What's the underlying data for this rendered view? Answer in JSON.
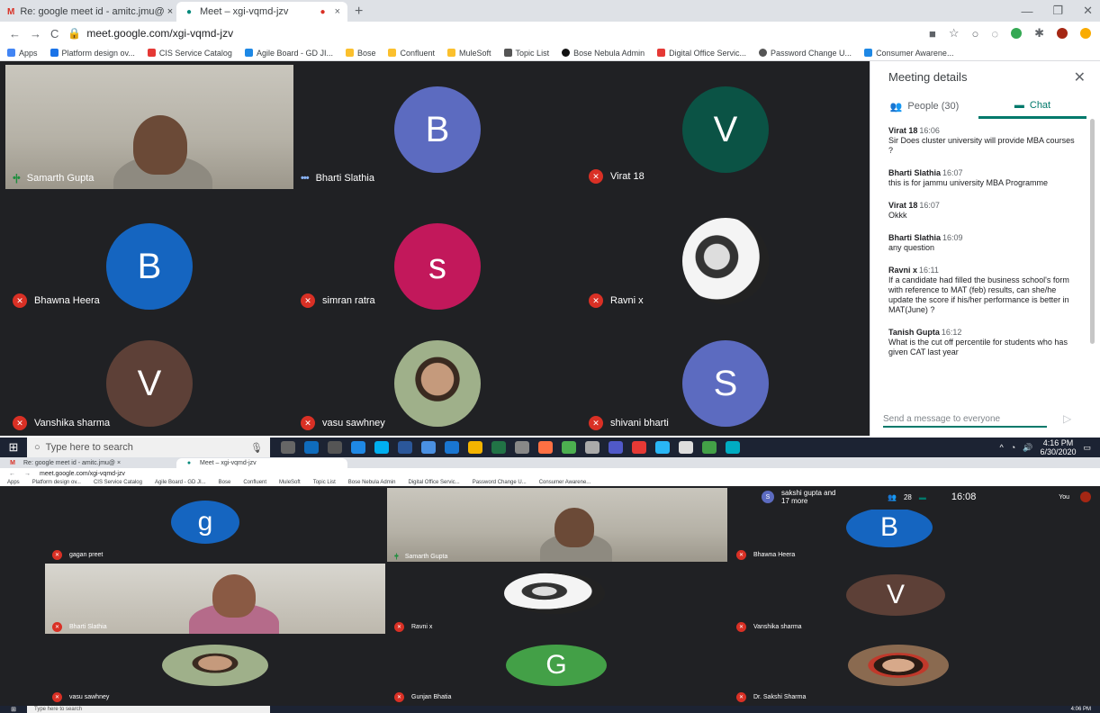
{
  "top": {
    "tabs": [
      {
        "label": "Re: google meet id - amitc.jmu@ ×"
      },
      {
        "label": "Meet – xgi-vqmd-jzv"
      }
    ],
    "url": "meet.google.com/xgi-vqmd-jzv",
    "bookmarks": [
      "Apps",
      "Platform design ov...",
      "CIS Service Catalog",
      "Agile Board - GD JI...",
      "Bose",
      "Confluent",
      "MuleSoft",
      "Topic List",
      "Bose Nebula Admin",
      "Digital Office Servic...",
      "Password Change U...",
      "Consumer Awarene..."
    ],
    "tiles": [
      {
        "name": "Samarth Gupta",
        "initial": "",
        "color": ""
      },
      {
        "name": "Bharti Slathia",
        "initial": "B",
        "color": "#5c6bc0"
      },
      {
        "name": "Virat 18",
        "initial": "V",
        "color": "#0b5345"
      },
      {
        "name": "Bhawna Heera",
        "initial": "B",
        "color": "#1565c0"
      },
      {
        "name": "simran ratra",
        "initial": "s",
        "color": "#c2185b"
      },
      {
        "name": "Ravni x",
        "initial": "",
        "color": ""
      },
      {
        "name": "Vanshika sharma",
        "initial": "V",
        "color": "#5d4037"
      },
      {
        "name": "vasu sawhney",
        "initial": "",
        "color": ""
      },
      {
        "name": "shivani bharti",
        "initial": "S",
        "color": "#5c6bc0"
      }
    ],
    "panel": {
      "title": "Meeting details",
      "people_tab": "People (30)",
      "chat_tab": "Chat",
      "messages": [
        {
          "who": "Virat 18",
          "time": "16:06",
          "text": "Sir Does cluster university will provide MBA courses ?"
        },
        {
          "who": "Bharti Slathia",
          "time": "16:07",
          "text": "this is for jammu university MBA Programme"
        },
        {
          "who": "Virat 18",
          "time": "16:07",
          "text": "Okkk"
        },
        {
          "who": "Bharti Slathia",
          "time": "16:09",
          "text": "any question"
        },
        {
          "who": "Ravni x",
          "time": "16:11",
          "text": "If a candidate had filled the business school's form with reference to MAT (feb) results, can she/he update the score if his/her performance is better in MAT(June) ?"
        },
        {
          "who": "Tanish Gupta",
          "time": "16:12",
          "text": "What is the cut off percentile for students who has given CAT last year"
        }
      ],
      "send_placeholder": "Send a message to everyone"
    },
    "taskbar": {
      "search": "Type here to search",
      "time": "4:16 PM",
      "date": "6/30/2020"
    }
  },
  "bottom": {
    "tabs": [
      {
        "label": "Re: google meet id - amitc.jmu@ ×"
      },
      {
        "label": "Meet – xgi-vqmd-jzv"
      }
    ],
    "url": "meet.google.com/xgi-vqmd-jzv",
    "presenter_note": "sakshi gupta and 17 more",
    "people_count": "28",
    "clock": "16:08",
    "you_label": "You",
    "tiles": [
      {
        "name": "gagan preet",
        "initial": "g",
        "color": "#1565c0"
      },
      {
        "name": "Samarth Gupta",
        "initial": "",
        "color": ""
      },
      {
        "name": "Bhawna Heera",
        "initial": "B",
        "color": "#1565c0"
      },
      {
        "name": "Bharti Slathia",
        "initial": "",
        "color": ""
      },
      {
        "name": "Ravni x",
        "initial": "",
        "color": ""
      },
      {
        "name": "Vanshika sharma",
        "initial": "V",
        "color": "#5d4037"
      },
      {
        "name": "vasu sawhney",
        "initial": "",
        "color": ""
      },
      {
        "name": "Gunjan Bhatia",
        "initial": "G",
        "color": "#43a047"
      },
      {
        "name": "Dr. Sakshi Sharma",
        "initial": "",
        "color": ""
      }
    ],
    "taskbar": {
      "search": "Type here to search",
      "time": "4:06 PM"
    }
  }
}
